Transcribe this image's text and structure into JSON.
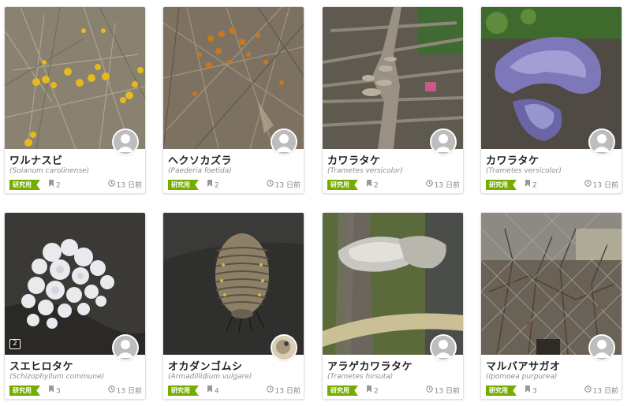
{
  "observations": [
    {
      "name": "ワルナスビ",
      "scientific": "(Solanum carolinense)",
      "badge": "研究用",
      "ids": "2",
      "time": "13 日前",
      "photo_icon": "yellow-berries-photo"
    },
    {
      "name": "ヘクソカズラ",
      "scientific": "(Paederia foetida)",
      "badge": "研究用",
      "ids": "2",
      "time": "13 日前",
      "photo_icon": "vine-berries-photo"
    },
    {
      "name": "カワラタケ",
      "scientific": "(Trametes versicolor)",
      "badge": "研究用",
      "ids": "2",
      "time": "13 日前",
      "photo_icon": "bracket-fungus-log-photo"
    },
    {
      "name": "カワラタケ",
      "scientific": "(Trametes versicolor)",
      "badge": "研究用",
      "ids": "2",
      "time": "13 日前",
      "photo_icon": "purple-fungus-photo"
    },
    {
      "name": "スエヒロタケ",
      "scientific": "(Schizophyllum commune)",
      "badge": "研究用",
      "ids": "3",
      "time": "13 日前",
      "photo_icon": "white-fungus-photo",
      "photo_count": "2"
    },
    {
      "name": "オカダンゴムシ",
      "scientific": "(Armadillidium vulgare)",
      "badge": "研究用",
      "ids": "4",
      "time": "13 日前",
      "photo_icon": "pill-bug-photo"
    },
    {
      "name": "アラゲカワラタケ",
      "scientific": "(Trametes hirsuta)",
      "badge": "研究用",
      "ids": "2",
      "time": "13 日前",
      "photo_icon": "hairy-bracket-photo"
    },
    {
      "name": "マルバアサガオ",
      "scientific": "(Ipomoea purpurea)",
      "badge": "研究用",
      "ids": "3",
      "time": "13 日前",
      "photo_icon": "dry-vine-fence-photo"
    }
  ],
  "colors": {
    "badge": "#74ac00",
    "muted": "#888888"
  }
}
